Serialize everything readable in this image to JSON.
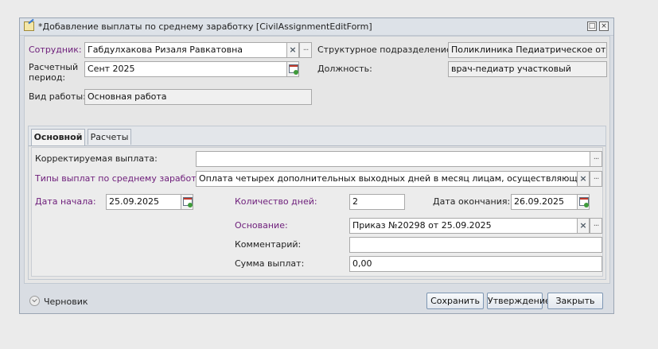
{
  "window": {
    "title": "*Добавление выплаты по среднему заработку [CivilAssignmentEditForm]"
  },
  "header": {
    "employee_label": "Сотрудник:",
    "employee_value": "Габдулхакова Ризаля Равкатовна",
    "department_label": "Структурное подразделение:",
    "department_value": "Поликлиника Педиатрическое отдел",
    "period_label_1": "Расчетный",
    "period_label_2": "период:",
    "period_value": "Сент 2025",
    "position_label": "Должность:",
    "position_value": "врач-педиатр участковый",
    "work_type_label": "Вид работы:",
    "work_type_value": "Основная работа"
  },
  "tabs": [
    {
      "label": "Основной",
      "active": true
    },
    {
      "label": "Расчеты",
      "active": false
    }
  ],
  "main": {
    "corrected_label": "Корректируемая выплата:",
    "corrected_value": "",
    "payment_types_label": "Типы выплат по среднему заработку:",
    "payment_types_value": "Оплата четырех дополнительных выходных дней в месяц лицам, осуществляющим уход за",
    "start_date_label": "Дата начала:",
    "start_date_value": "25.09.2025",
    "days_label": "Количество дней:",
    "days_value": "2",
    "end_date_label": "Дата окончания:",
    "end_date_value": "26.09.2025",
    "basis_label": "Основание:",
    "basis_value": "Приказ №20298 от 25.09.2025",
    "comment_label": "Комментарий:",
    "comment_value": "",
    "sum_label": "Сумма выплат:",
    "sum_value": "0,00"
  },
  "footer": {
    "status": "Черновик",
    "save_label": "Сохранить",
    "approve_label": "Утверждение",
    "close_label": "Закрыть"
  },
  "icons": {
    "clear": "×",
    "more": "...",
    "maximize": "□",
    "close": "×"
  },
  "colors": {
    "required_label": "#6d1d7a",
    "window_bg": "#d9dde3",
    "button_border": "#7d96b3"
  }
}
